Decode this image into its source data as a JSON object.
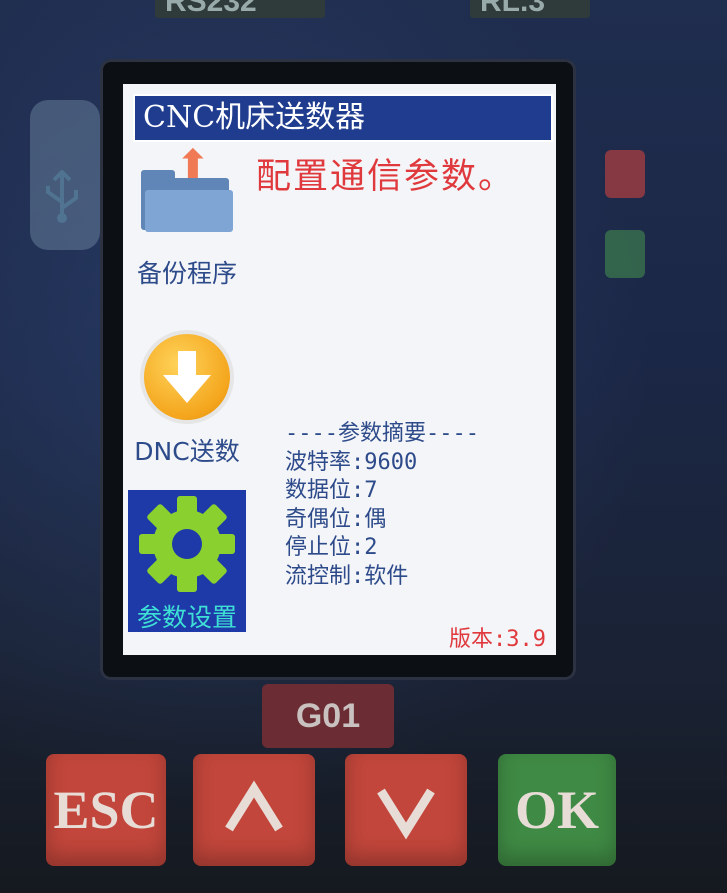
{
  "device": {
    "top_label_left": "RS232",
    "top_label_right": "RL.3",
    "usb_icon": "usb-icon"
  },
  "screen": {
    "title": "CNC机床送数器",
    "status_message": "配置通信参数。",
    "menu": [
      {
        "label": "备份程序",
        "icon": "folder-upload-icon",
        "selected": false
      },
      {
        "label": "DNC送数",
        "icon": "download-arrow-icon",
        "selected": false
      },
      {
        "label": "参数设置",
        "icon": "gear-icon",
        "selected": true
      }
    ],
    "params": {
      "heading": "----参数摘要----",
      "baud": "波特率:9600",
      "data_bits": "数据位:7",
      "parity": "奇偶位:偶",
      "stop_bits": "停止位:2",
      "flow_control": "流控制:软件"
    },
    "version": "版本:3.9"
  },
  "keys": {
    "g01": "G01",
    "esc": "ESC",
    "up": "up-arrow-icon",
    "down": "down-arrow-icon",
    "ok": "OK"
  },
  "colors": {
    "title_bar": "#1f3c8f",
    "status_text": "#e0393d",
    "selected_bg": "#1d3aa8",
    "selected_text": "#3ee0d6",
    "param_text": "#2d4a8a",
    "gear": "#8ad12f",
    "key_red": "#c2463b",
    "key_green": "#3f8a44"
  }
}
